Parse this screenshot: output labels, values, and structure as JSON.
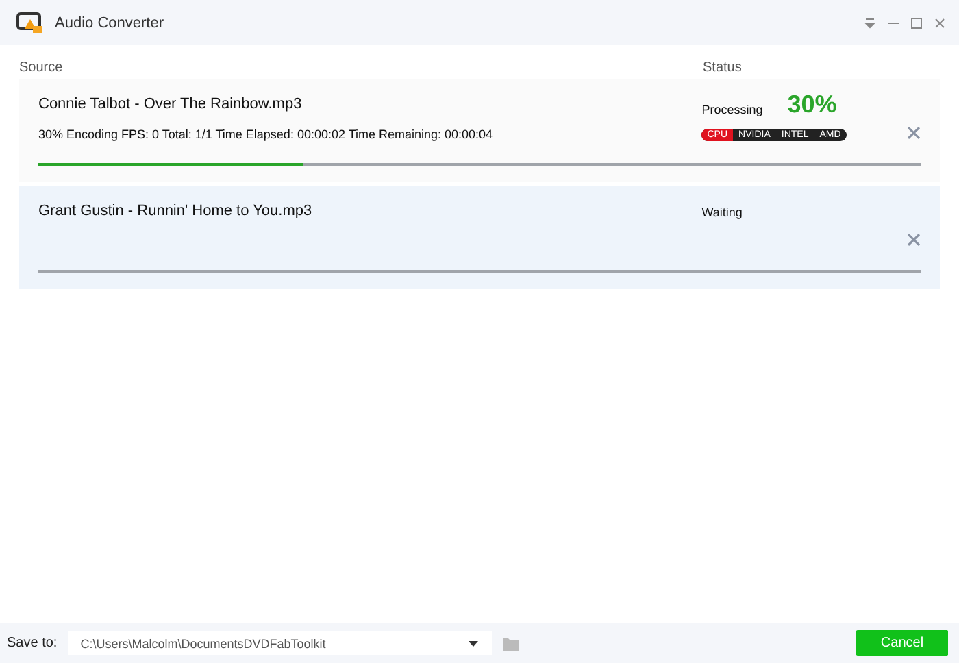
{
  "window": {
    "title": "Audio Converter"
  },
  "columns": [
    "Source",
    "Status"
  ],
  "items": [
    {
      "name": "Connie Talbot - Over The Rainbow.mp3",
      "details": "30% Encoding FPS: 0 Total: 1/1 Time Elapsed: 00:00:02 Time Remaining: 00:00:04",
      "status": "Processing",
      "percent": "30%",
      "encoders": [
        {
          "label": "CPU",
          "selected": true
        },
        {
          "label": "NVIDIA",
          "selected": false
        },
        {
          "label": "INTEL",
          "selected": false
        },
        {
          "label": "AMD",
          "selected": false
        }
      ],
      "level": 0.3,
      "selected": false
    },
    {
      "name": "Grant Gustin - Runnin' Home to You.mp3",
      "status": "Waiting",
      "selected": true
    }
  ],
  "footer": {
    "save_label": "Save to:",
    "path": "C:\\Users\\Malcolm\\DocumentsDVDFabToolkit",
    "cancel": "Cancel"
  }
}
